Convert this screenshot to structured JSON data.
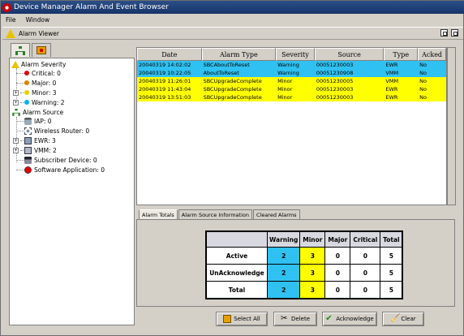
{
  "window": {
    "title": "Device Manager Alarm And Event Browser"
  },
  "menu": {
    "file": "File",
    "window": "Window"
  },
  "panel": {
    "title": "Alarm Viewer"
  },
  "tree": {
    "severity_root": "Alarm Severity",
    "severity_items": [
      {
        "label": "Critical: 0",
        "color": "#e00000"
      },
      {
        "label": "Major: 0",
        "color": "#e08000"
      },
      {
        "label": "Minor: 3",
        "color": "#e8d000"
      },
      {
        "label": "Warning: 2",
        "color": "#00b0e8"
      }
    ],
    "source_root": "Alarm Source",
    "source_items": [
      {
        "label": "IAP: 0",
        "icon": "iap-icon"
      },
      {
        "label": "Wireless Router: 0",
        "icon": "router-icon"
      },
      {
        "label": "EWR: 3",
        "icon": "ewr-icon"
      },
      {
        "label": "VMM: 2",
        "icon": "vmm-icon"
      },
      {
        "label": "Subscriber Device: 0",
        "icon": "subscriber-icon"
      },
      {
        "label": "Software Application: 0",
        "icon": "software-icon"
      }
    ]
  },
  "table": {
    "columns": [
      "Date",
      "Alarm Type",
      "Severity",
      "Source",
      "Type",
      "Acked"
    ],
    "rows": [
      {
        "date": "20040319 14:02:02",
        "alarm_type": "SBCAboutToReset",
        "severity": "Warning",
        "source": "00051230003",
        "type": "EWR",
        "acked": "No",
        "color": "#2fc1f1"
      },
      {
        "date": "20040319 10:22:05",
        "alarm_type": "AboutToReset",
        "severity": "Warning",
        "source": "00051230908",
        "type": "VMM",
        "acked": "No",
        "color": "#2fc1f1"
      },
      {
        "date": "20040319 11:26:01",
        "alarm_type": "SBCUpgradeComplete",
        "severity": "Minor",
        "source": "00051230005",
        "type": "VMM",
        "acked": "No",
        "color": "#ffff00"
      },
      {
        "date": "20040319 11:43:04",
        "alarm_type": "SBCUpgradeComplete",
        "severity": "Minor",
        "source": "00051230003",
        "type": "EWR",
        "acked": "No",
        "color": "#ffff00"
      },
      {
        "date": "20040319 13:51:03",
        "alarm_type": "SBCUpgradeComplete",
        "severity": "Minor",
        "source": "00051230003",
        "type": "EWR",
        "acked": "No",
        "color": "#ffff00"
      }
    ]
  },
  "bottom_tabs": [
    "Alarm Totals",
    "Alarm Source Information",
    "Cleared Alarms"
  ],
  "totals": {
    "columns": [
      "Warning",
      "Minor",
      "Major",
      "Critical",
      "Total"
    ],
    "rows": [
      {
        "label": "Active",
        "values": [
          "2",
          "3",
          "0",
          "0",
          "5"
        ]
      },
      {
        "label": "UnAcknowledge",
        "values": [
          "2",
          "3",
          "0",
          "0",
          "5"
        ]
      },
      {
        "label": "Total",
        "values": [
          "2",
          "3",
          "0",
          "0",
          "5"
        ]
      }
    ]
  },
  "buttons": {
    "select_all": "Select All",
    "delete": "Delete",
    "acknowledge": "Acknowledge",
    "clear": "Clear"
  },
  "colors": {
    "warning": "#2fc1f1",
    "minor": "#ffff00",
    "titlebar": "#1f3f78"
  }
}
